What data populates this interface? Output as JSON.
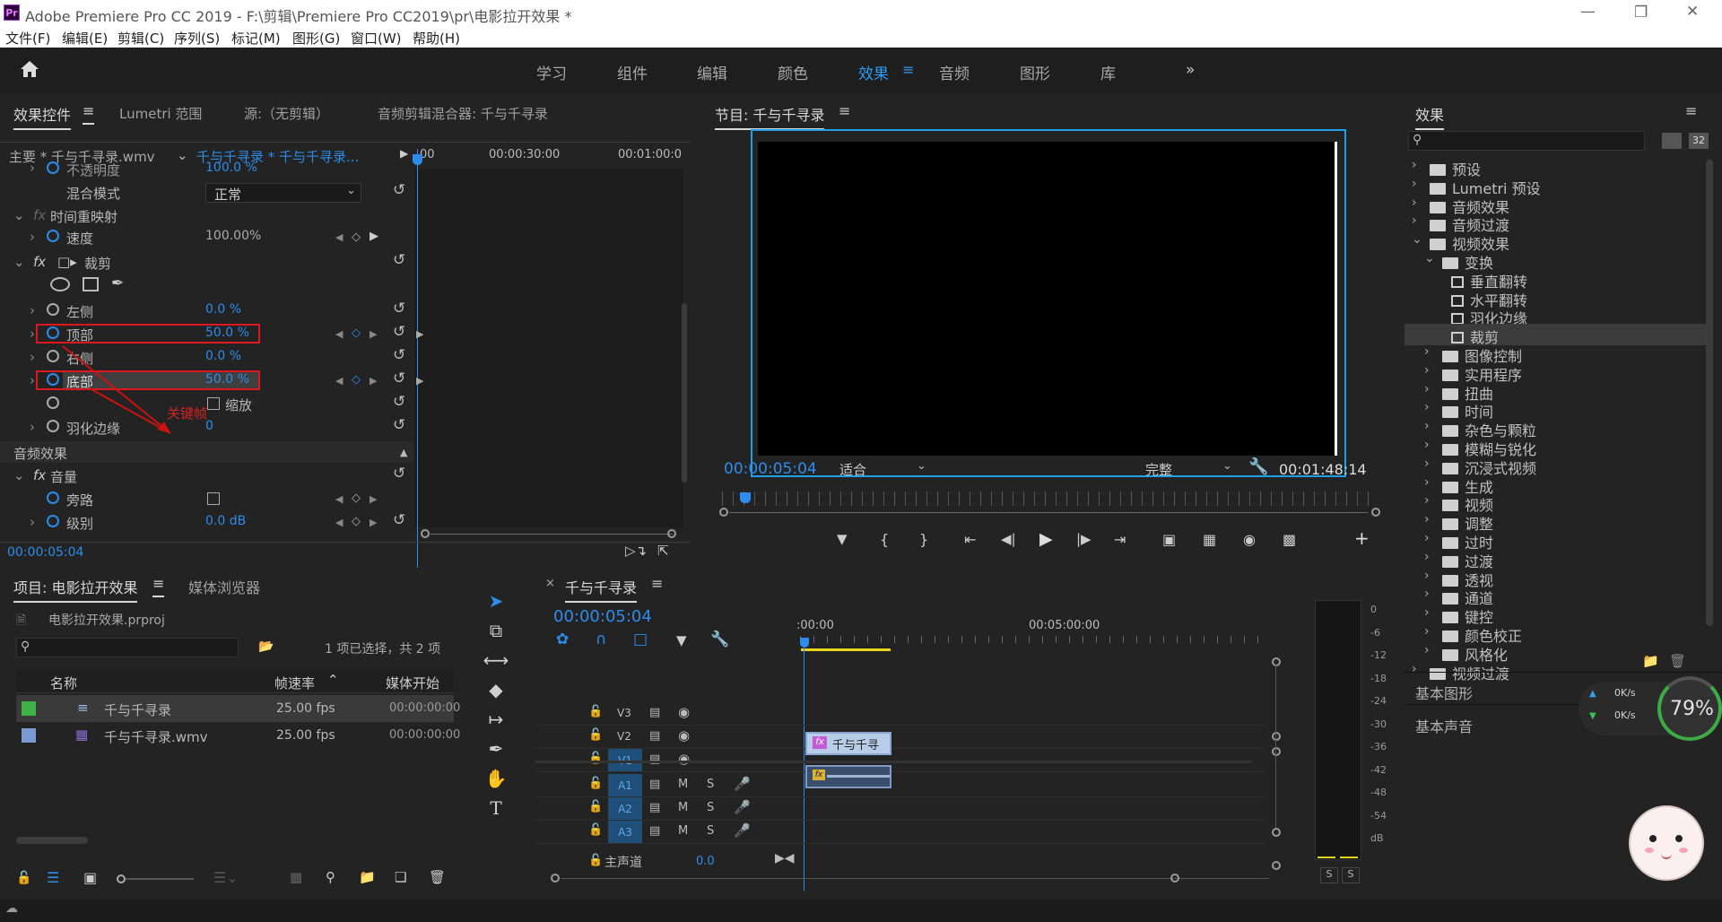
{
  "app": {
    "icon": "Pr",
    "title": "Adobe Premiere Pro CC 2019 - F:\\剪辑\\Premiere Pro CC2019\\pr\\电影拉开效果 *"
  },
  "menu": [
    "文件(F)",
    "编辑(E)",
    "剪辑(C)",
    "序列(S)",
    "标记(M)",
    "图形(G)",
    "窗口(W)",
    "帮助(H)"
  ],
  "workspaces": [
    "学习",
    "组件",
    "编辑",
    "颜色",
    "效果",
    "音频",
    "图形",
    "库"
  ],
  "workspace_active": "效果",
  "effect_controls": {
    "tabs": [
      "效果控件",
      "Lumetri 范围",
      "源:（无剪辑）",
      "音频剪辑混合器: 千与千寻录"
    ],
    "master": "主要 * 千与千寻录.wmv",
    "clip": "千与千寻录 * 千与千寻录...",
    "ruler": [
      "00",
      "00:00:30:00",
      "00:01:00:0"
    ],
    "opacity_label": "不透明度",
    "opacity_value": "100.0 %",
    "blend_label": "混合模式",
    "blend_value": "正常",
    "timeremap": "时间重映射",
    "speed_label": "速度",
    "speed_value": "100.00%",
    "crop": "裁剪",
    "left_label": "左侧",
    "left_value": "0.0 %",
    "top_label": "顶部",
    "top_value": "50.0 %",
    "right_label": "右侧",
    "right_value": "0.0 %",
    "bottom_label": "底部",
    "bottom_value": "50.0 %",
    "annotation": "关键帧",
    "scale_label": "缩放",
    "feather_label": "羽化边缘",
    "feather_value": "0",
    "audio_effects": "音频效果",
    "volume": "音量",
    "bypass_label": "旁路",
    "level_label": "级别",
    "level_value": "0.0 dB",
    "timecode": "00:00:05:04"
  },
  "program": {
    "title": "节目: 千与千寻录",
    "timecode": "00:00:05:04",
    "fit": "适合",
    "quality": "完整",
    "duration": "00:01:48:14"
  },
  "effects": {
    "title": "效果",
    "search_placeholder": "",
    "tree": [
      {
        "label": "预设",
        "type": "folder",
        "level": 0,
        "open": false
      },
      {
        "label": "Lumetri 预设",
        "type": "folder",
        "level": 0,
        "open": false
      },
      {
        "label": "音频效果",
        "type": "folder",
        "level": 0,
        "open": false
      },
      {
        "label": "音频过渡",
        "type": "folder",
        "level": 0,
        "open": false
      },
      {
        "label": "视频效果",
        "type": "folder",
        "level": 0,
        "open": true
      },
      {
        "label": "变换",
        "type": "folder",
        "level": 1,
        "open": true
      },
      {
        "label": "垂直翻转",
        "type": "fx",
        "level": 2
      },
      {
        "label": "水平翻转",
        "type": "fx",
        "level": 2
      },
      {
        "label": "羽化边缘",
        "type": "fx",
        "level": 2
      },
      {
        "label": "裁剪",
        "type": "fx",
        "level": 2,
        "selected": true
      },
      {
        "label": "图像控制",
        "type": "folder",
        "level": 1,
        "open": false
      },
      {
        "label": "实用程序",
        "type": "folder",
        "level": 1,
        "open": false
      },
      {
        "label": "扭曲",
        "type": "folder",
        "level": 1,
        "open": false
      },
      {
        "label": "时间",
        "type": "folder",
        "level": 1,
        "open": false
      },
      {
        "label": "杂色与颗粒",
        "type": "folder",
        "level": 1,
        "open": false
      },
      {
        "label": "模糊与锐化",
        "type": "folder",
        "level": 1,
        "open": false
      },
      {
        "label": "沉浸式视频",
        "type": "folder",
        "level": 1,
        "open": false
      },
      {
        "label": "生成",
        "type": "folder",
        "level": 1,
        "open": false
      },
      {
        "label": "视频",
        "type": "folder",
        "level": 1,
        "open": false
      },
      {
        "label": "调整",
        "type": "folder",
        "level": 1,
        "open": false
      },
      {
        "label": "过时",
        "type": "folder",
        "level": 1,
        "open": false
      },
      {
        "label": "过渡",
        "type": "folder",
        "level": 1,
        "open": false
      },
      {
        "label": "透视",
        "type": "folder",
        "level": 1,
        "open": false
      },
      {
        "label": "通道",
        "type": "folder",
        "level": 1,
        "open": false
      },
      {
        "label": "键控",
        "type": "folder",
        "level": 1,
        "open": false
      },
      {
        "label": "颜色校正",
        "type": "folder",
        "level": 1,
        "open": false
      },
      {
        "label": "风格化",
        "type": "folder",
        "level": 1,
        "open": false
      },
      {
        "label": "视频过渡",
        "type": "folder",
        "level": 0,
        "open": false
      }
    ],
    "basic_graphics": "基本图形",
    "basic_sound": "基本声音"
  },
  "project": {
    "tabs": [
      "项目: 电影拉开效果",
      "媒体浏览器"
    ],
    "file": "电影拉开效果.prproj",
    "selection": "1 项已选择，共 2 项",
    "columns": [
      "名称",
      "帧速率",
      "媒体开始"
    ],
    "items": [
      {
        "name": "千与千寻录",
        "fps": "25.00 fps",
        "start": "00:00:00:00",
        "color": "#3fb24a"
      },
      {
        "name": "千与千寻录.wmv",
        "fps": "25.00 fps",
        "start": "00:00:00:00",
        "color": "#7b9ad4"
      }
    ]
  },
  "timeline": {
    "title": "千与千寻录",
    "timecode": "00:00:05:04",
    "ruler": [
      ":00:00",
      "00:05:00:00"
    ],
    "tracks": [
      "V3",
      "V2",
      "V1",
      "A1",
      "A2",
      "A3"
    ],
    "master_label": "主声道",
    "master_value": "0.0",
    "clip_label": "千与千寻"
  },
  "meter": {
    "labels": [
      "0",
      "-6",
      "-12",
      "-18",
      "-24",
      "-30",
      "-36",
      "-42",
      "-48",
      "-54",
      "dB"
    ],
    "solo": [
      "S",
      "S"
    ]
  },
  "widget": {
    "up": "0K/s",
    "down": "0K/s",
    "percent": "79%"
  }
}
